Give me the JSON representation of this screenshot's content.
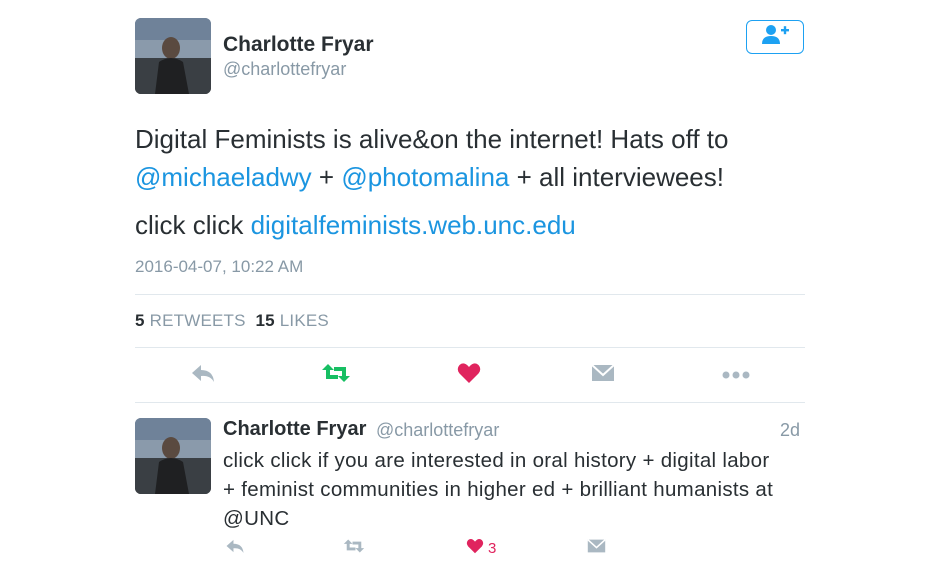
{
  "author": {
    "name": "Charlotte Fryar",
    "handle": "@charlottefryar"
  },
  "tweet": {
    "line1_text": "Digital Feminists is alive&on the internet! Hats off to",
    "mention1": "@michaeladwy",
    "connector1": " + ",
    "mention2": "@photomalina",
    "line2_rest": " + all interviewees!",
    "line3_text": "click click ",
    "link": "digitalfeminists.web.unc.edu",
    "timestamp": "2016-04-07, 10:22 AM"
  },
  "stats": {
    "retweets_count": "5",
    "retweets_label": "RETWEETS",
    "likes_count": "15",
    "likes_label": "LIKES"
  },
  "actions": [
    "reply-icon",
    "retweet-icon",
    "heart-icon",
    "envelope-icon",
    "more-icon"
  ],
  "reply": {
    "name": "Charlotte Fryar",
    "handle": "@charlottefryar",
    "time": "2d",
    "text_line1": "click click if you are interested in oral history + digital labor",
    "text_line2": "+ feminist communities in higher ed + brilliant humanists at",
    "text_line3": "@UNC",
    "like_count": "3"
  },
  "colors": {
    "link": "#1b95e0",
    "retweet_green": "#17bf63",
    "like_red": "#e0245e",
    "muted": "#8899a6",
    "divider": "#e1e8ed"
  }
}
